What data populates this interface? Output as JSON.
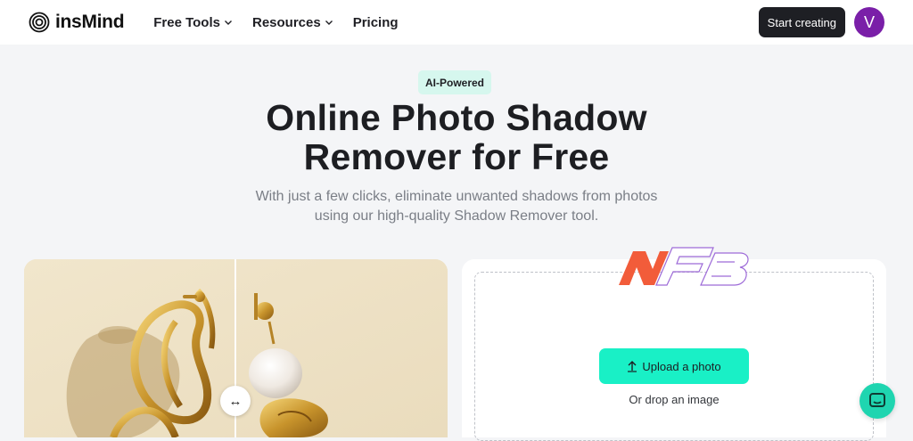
{
  "header": {
    "brand": "insMind",
    "nav": [
      {
        "label": "Free Tools",
        "has_dropdown": true
      },
      {
        "label": "Resources",
        "has_dropdown": true
      },
      {
        "label": "Pricing",
        "has_dropdown": false
      }
    ],
    "cta_label": "Start creating",
    "avatar_initial": "V",
    "avatar_color": "#7a1fa8"
  },
  "hero": {
    "badge": "AI-Powered",
    "title_line1": "Online Photo Shadow",
    "title_line2": "Remover for Free",
    "subtitle_line1": "With just a few clicks, eliminate unwanted shadows from photos",
    "subtitle_line2": "using our high-quality Shadow Remover tool."
  },
  "preview": {
    "handle_glyph": "↔"
  },
  "upload": {
    "button_icon": "upload-arrow-icon",
    "button_label": "Upload a photo",
    "drop_text": "Or drop an image",
    "accent_color": "#19f0c6"
  },
  "watermark": {
    "text": "NFB"
  },
  "chat": {
    "icon": "chat-icon"
  }
}
